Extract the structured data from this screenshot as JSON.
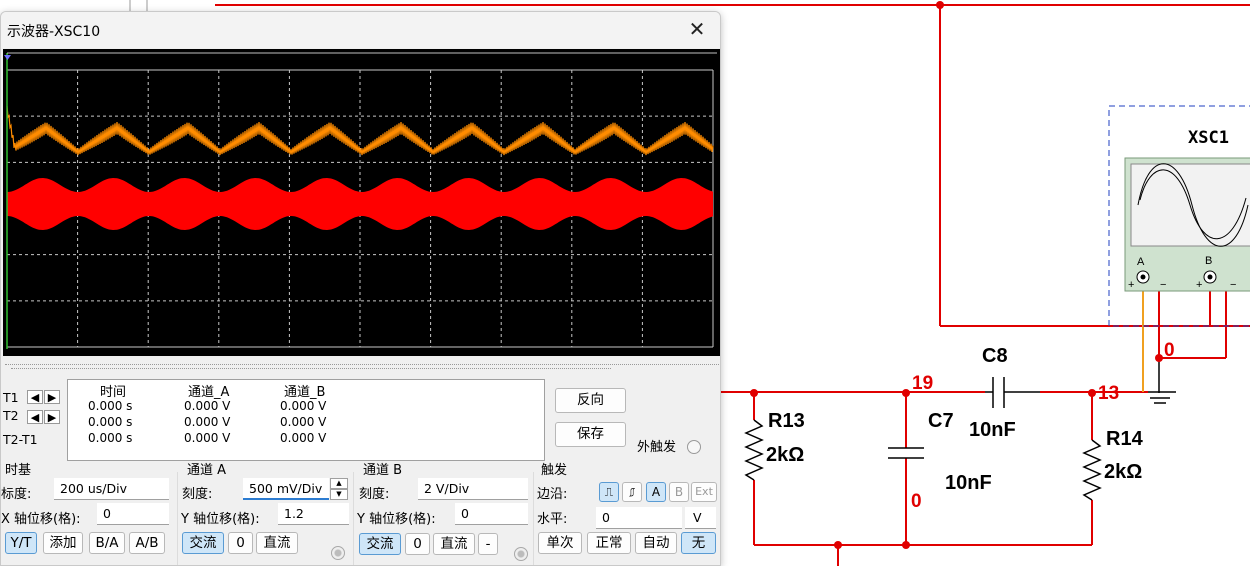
{
  "window": {
    "title": "示波器-XSC10",
    "close_glyph": "✕"
  },
  "readout": {
    "cursors": [
      "T1",
      "T2",
      "T2-T1"
    ],
    "headers": {
      "time": "时间",
      "channel_a": "通道_A",
      "channel_b": "通道_B"
    },
    "rows": [
      {
        "time": "0.000 s",
        "a": "0.000 V",
        "b": "0.000 V"
      },
      {
        "time": "0.000 s",
        "a": "0.000 V",
        "b": "0.000 V"
      },
      {
        "time": "0.000 s",
        "a": "0.000 V",
        "b": "0.000 V"
      }
    ],
    "reverse_button": "反向",
    "save_button": "保存",
    "ext_trigger_label": "外触发"
  },
  "timebase": {
    "title": "时基",
    "scale_label": "标度:",
    "scale_value": "200 us/Div",
    "xpos_label": "X 轴位移(格):",
    "xpos_value": "0",
    "mode_buttons": [
      "Y/T",
      "添加",
      "B/A",
      "A/B"
    ]
  },
  "channel_a": {
    "title": "通道 A",
    "scale_label": "刻度:",
    "scale_value": "500 mV/Div",
    "ypos_label": "Y 轴位移(格):",
    "ypos_value": "1.2",
    "coupling": [
      "交流",
      "0",
      "直流"
    ]
  },
  "channel_b": {
    "title": "通道 B",
    "scale_label": "刻度:",
    "scale_value": "2  V/Div",
    "ypos_label": "Y 轴位移(格):",
    "ypos_value": "0",
    "coupling": [
      "交流",
      "0",
      "直流",
      "-"
    ]
  },
  "trigger": {
    "title": "触发",
    "edge_label": "边沿:",
    "edge_buttons": [
      "A",
      "B",
      "Ext"
    ],
    "level_label": "水平:",
    "level_value": "0",
    "level_unit": "V",
    "mode_buttons": [
      "单次",
      "正常",
      "自动",
      "无"
    ]
  },
  "schematic": {
    "instrument": "XSC1",
    "instrument_channels": [
      "A",
      "B"
    ],
    "terminal_plus": "+",
    "terminal_minus": "−",
    "nets": [
      "19",
      "13",
      "0",
      "0",
      "0"
    ],
    "components": [
      {
        "ref": "R13",
        "value": "2kΩ"
      },
      {
        "ref": "C7",
        "value": "10nF"
      },
      {
        "ref": "C8",
        "value": "10nF"
      },
      {
        "ref": "R14",
        "value": "2kΩ"
      }
    ],
    "colors": {
      "wire": "#e00000",
      "probe_a": "#f0a020",
      "probe_b": "#e00000"
    }
  },
  "trace_colors": {
    "channel_a": "#ff8c00",
    "channel_b": "#ff0000",
    "grid": "#c8c8c8"
  }
}
